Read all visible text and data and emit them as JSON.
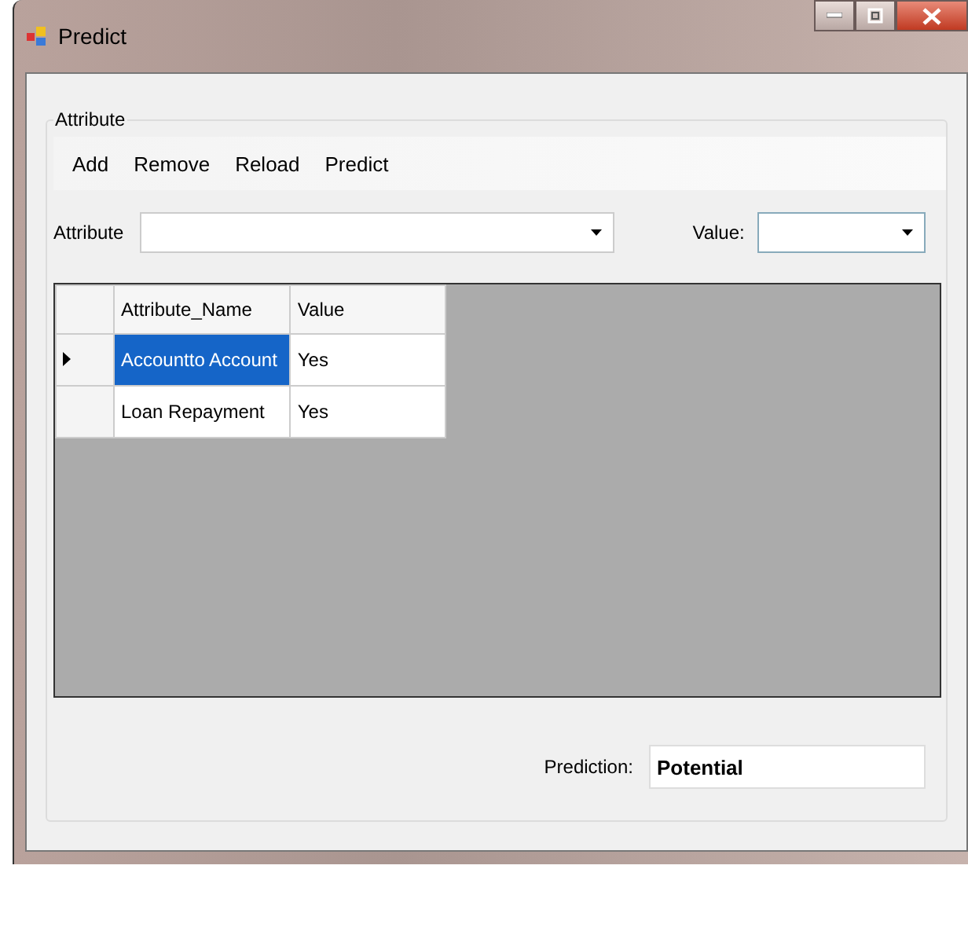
{
  "window": {
    "title": "Predict"
  },
  "group": {
    "title": "Attribute"
  },
  "toolbar": [
    "Add",
    "Remove",
    "Reload",
    "Predict"
  ],
  "attribute_field": {
    "label": "Attribute"
  },
  "value_field": {
    "label": "Value:"
  },
  "table": {
    "columns": [
      "Attribute_Name",
      "Value"
    ],
    "rows": [
      {
        "cells": [
          "Accountto Account",
          "Yes"
        ],
        "selected": true
      },
      {
        "cells": [
          "Loan Repayment",
          "Yes"
        ],
        "selected": false
      }
    ]
  },
  "prediction": {
    "label": "Prediction:",
    "value": "Potential"
  }
}
